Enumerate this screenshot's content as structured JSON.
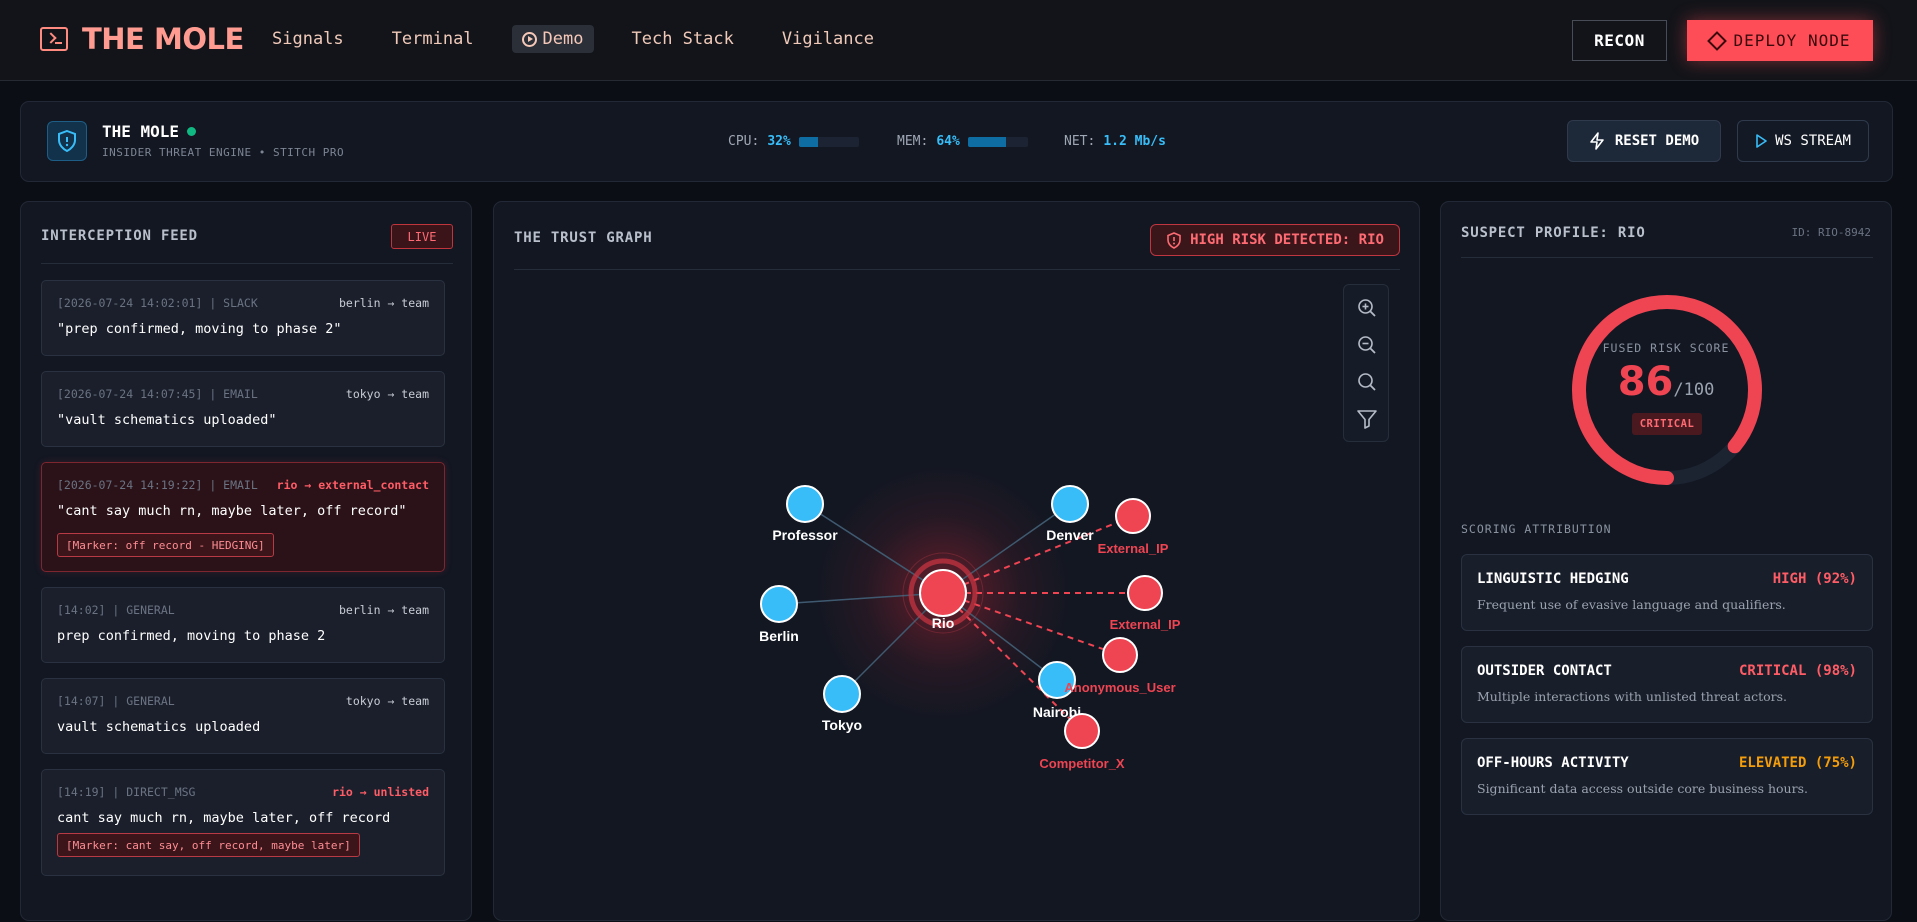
{
  "header": {
    "brand": "THE MOLE",
    "nav": [
      "Signals",
      "Terminal",
      "Demo",
      "Tech Stack",
      "Vigilance"
    ],
    "recon_label": "RECON",
    "deploy_label": "DEPLOY NODE"
  },
  "status": {
    "title": "THE MOLE",
    "subtitle": "INSIDER THREAT ENGINE • STITCH PRO",
    "cpu_label": "CPU:",
    "cpu_value": "32%",
    "cpu_fraction": 0.32,
    "mem_label": "MEM:",
    "mem_value": "64%",
    "mem_fraction": 0.64,
    "net_label": "NET:",
    "net_value": "1.2 Mb/s",
    "reset_label": "RESET DEMO",
    "ws_label": "WS STREAM"
  },
  "feed": {
    "title": "INTERCEPTION FEED",
    "live": "LIVE",
    "messages": [
      {
        "meta": "[2026-07-24 14:02:01] | SLACK",
        "route": "berlin → team",
        "text": "\"prep confirmed, moving to phase 2\"",
        "marker": ""
      },
      {
        "meta": "[2026-07-24 14:07:45] | EMAIL",
        "route": "tokyo → team",
        "text": "\"vault schematics uploaded\"",
        "marker": ""
      },
      {
        "meta": "[2026-07-24 14:19:22] | EMAIL",
        "route": "rio → external_contact",
        "text": "\"cant say much rn, maybe later, off record\"",
        "marker": "[Marker: off record - HEDGING]"
      },
      {
        "meta": "[14:02] | GENERAL",
        "route": "berlin → team",
        "text": "prep confirmed, moving to phase 2",
        "marker": ""
      },
      {
        "meta": "[14:07] | GENERAL",
        "route": "tokyo → team",
        "text": "vault schematics uploaded",
        "marker": ""
      },
      {
        "meta": "[14:19] | DIRECT_MSG",
        "route": "rio → unlisted",
        "text": "cant say much rn, maybe later, off record",
        "marker": "[Marker: cant say, off record, maybe later]"
      }
    ]
  },
  "graph": {
    "title": "THE TRUST GRAPH",
    "risk_badge": "HIGH RISK DETECTED: RIO",
    "center": "Rio",
    "trusted_nodes": [
      "Professor",
      "Denver",
      "Berlin",
      "Tokyo",
      "Nairobi"
    ],
    "threat_nodes": [
      "External_IP",
      "External_IP",
      "Anonymous_User",
      "Competitor_X"
    ],
    "colors": {
      "trusted": "#38bdf8",
      "threat": "#ef4452"
    }
  },
  "profile": {
    "title": "SUSPECT PROFILE: RIO",
    "id": "ID: RIO-8942",
    "gauge_label": "FUSED RISK SCORE",
    "score": "86",
    "score_max": "/100",
    "score_fraction": 0.86,
    "level": "CRITICAL",
    "attribution_title": "SCORING ATTRIBUTION",
    "factors": [
      {
        "name": "LINGUISTIC HEDGING",
        "score": "HIGH (92%)",
        "desc": "Frequent use of evasive language and qualifiers.",
        "color": "#ff5c66"
      },
      {
        "name": "OUTSIDER CONTACT",
        "score": "CRITICAL (98%)",
        "desc": "Multiple interactions with unlisted threat actors.",
        "color": "#ff5c66"
      },
      {
        "name": "OFF-HOURS ACTIVITY",
        "score": "ELEVATED (75%)",
        "desc": "Significant data access outside core business hours.",
        "color": "#f59e0b"
      }
    ]
  }
}
